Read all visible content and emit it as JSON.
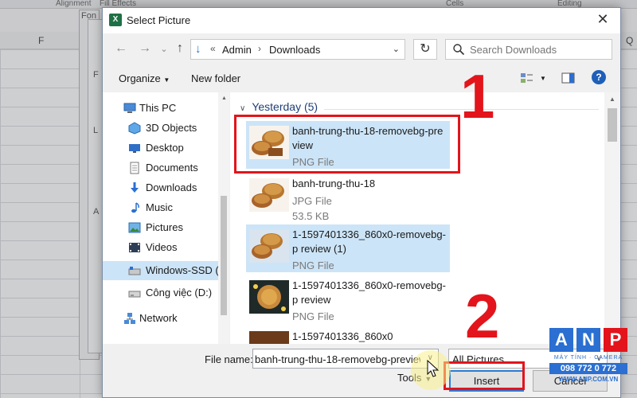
{
  "background": {
    "ribbon": [
      "Alignment",
      "Fill Effects",
      "Cells",
      "Editing"
    ],
    "column_headers": [
      "F",
      "Q"
    ],
    "behind_labels": [
      "Fon",
      "F",
      "L",
      "A"
    ]
  },
  "dialog": {
    "title": "Select Picture",
    "close_label": "✕"
  },
  "address_bar": {
    "overflow": "«",
    "breadcrumb": [
      "Admin",
      "Downloads"
    ],
    "separator": "›"
  },
  "search": {
    "placeholder": "Search Downloads"
  },
  "toolbar": {
    "organize": "Organize",
    "new_folder": "New folder",
    "help": "?"
  },
  "nav_pane": {
    "items": [
      {
        "label": "This PC",
        "icon": "this-pc-icon"
      },
      {
        "label": "3D Objects",
        "icon": "3d-objects-icon"
      },
      {
        "label": "Desktop",
        "icon": "desktop-icon"
      },
      {
        "label": "Documents",
        "icon": "documents-icon"
      },
      {
        "label": "Downloads",
        "icon": "downloads-icon"
      },
      {
        "label": "Music",
        "icon": "music-icon"
      },
      {
        "label": "Pictures",
        "icon": "pictures-icon"
      },
      {
        "label": "Videos",
        "icon": "videos-icon"
      },
      {
        "label": "Windows-SSD (C",
        "icon": "drive-c-icon",
        "selected": true
      },
      {
        "label": "Công việc (D:)",
        "icon": "drive-d-icon"
      },
      {
        "label": "Network",
        "icon": "network-icon"
      }
    ]
  },
  "file_list": {
    "group_header": "Yesterday (5)",
    "files": [
      {
        "name": "banhtrung-thu-18-removebg-preview",
        "display": "banh-trung-thu-18-removebg-pre view",
        "type": "PNG File",
        "size": "",
        "highlighted": true
      },
      {
        "name": "banh-trung-thu-18",
        "display": "banh-trung-thu-18",
        "type": "JPG File",
        "size": "53.5 KB",
        "highlighted": false
      },
      {
        "name": "1-1597401336_860x0-removebg-preview (1)",
        "display": "1-1597401336_860x0-removebg-p review (1)",
        "type": "PNG File",
        "size": "",
        "highlighted": true
      },
      {
        "name": "1-1597401336_860x0-removebg-preview",
        "display": "1-1597401336_860x0-removebg-p review",
        "type": "PNG File",
        "size": "",
        "highlighted": false
      },
      {
        "name": "1-1597401336_860x0",
        "display": "1-1597401336_860x0",
        "type": "",
        "size": "",
        "highlighted": false
      }
    ]
  },
  "bottom": {
    "file_name_label": "File name:",
    "file_name_value": "banh-trung-thu-18-removebg-preview",
    "file_type": "All Pictures",
    "tools_label": "Tools",
    "insert_label": "Insert",
    "cancel_label": "Cancel"
  },
  "annotations": {
    "step1": "1",
    "step2": "2",
    "color": "#e3141b"
  },
  "watermark": {
    "letters": [
      "A",
      "N",
      "P"
    ],
    "tagline": "MÁY TÍNH · CAMERA",
    "phone": "098 772 0 772",
    "url": "WWW.ANP.COM.VN"
  }
}
